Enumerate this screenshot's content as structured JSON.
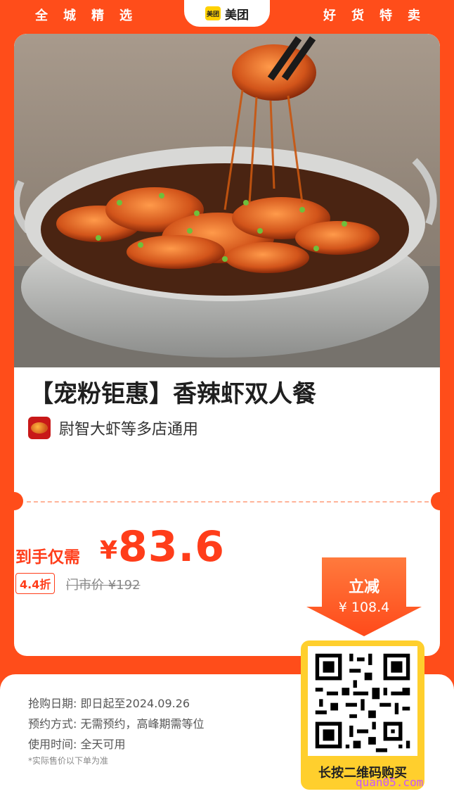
{
  "header": {
    "left_slogan": [
      "全",
      "城",
      "精",
      "选"
    ],
    "right_slogan": [
      "好",
      "货",
      "特",
      "卖"
    ],
    "brand_mark": "美团",
    "brand_name": "美团"
  },
  "product": {
    "title": "【宠粉钜惠】香辣虾双人餐",
    "store": "尉智大虾等多店通用"
  },
  "pricing": {
    "label": "到手仅需",
    "currency": "¥",
    "price": "83.6",
    "discount": "4.4折",
    "original_price": "门市价 ¥192",
    "cut_title": "立减",
    "cut_value": "¥ 108.4"
  },
  "info": {
    "purchase_date_key": "抢购日期:",
    "purchase_date_val": "即日起至2024.09.26",
    "booking_key": "预约方式:",
    "booking_val": "无需预约，高峰期需等位",
    "usage_key": "使用时间:",
    "usage_val": "全天可用",
    "note": "*实际售价以下单为准"
  },
  "qr": {
    "caption": "长按二维码购买"
  },
  "watermark": "quan05.com",
  "colors": {
    "brand_orange": "#ff4d1a",
    "price_red": "#ff3d1a",
    "qr_yellow": "#ffcf2d",
    "meituan_yellow": "#ffd100"
  }
}
